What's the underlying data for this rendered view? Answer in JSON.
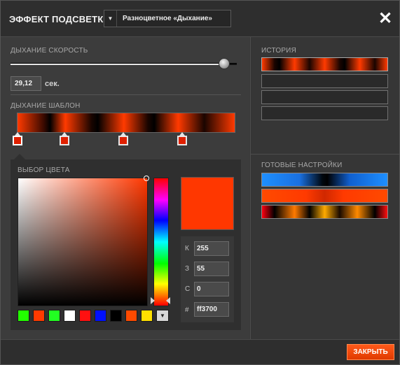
{
  "window": {
    "title": "ЭФФЕКТ ПОДСВЕТКИ",
    "effect_dropdown": {
      "arrow": "▼",
      "selected": "Разноцветное «Дыхание»"
    },
    "close_glyph": "✕"
  },
  "speed": {
    "label": "ДЫХАНИЕ СКОРОСТЬ",
    "value": "29,12",
    "unit": "сек.",
    "slider_fraction": 0.96
  },
  "pattern": {
    "label": "ДЫХАНИЕ ШАБЛОН",
    "stops": [
      {
        "color": "#e02000"
      },
      {
        "color": "#e02000"
      },
      {
        "color": "#e02000"
      },
      {
        "color": "#e02000"
      }
    ]
  },
  "color_picker": {
    "label": "ВЫБОР ЦВЕТА",
    "preview_color": "#ff3700",
    "fields": [
      {
        "label": "К",
        "value": "255"
      },
      {
        "label": "З",
        "value": "55"
      },
      {
        "label": "С",
        "value": "0"
      },
      {
        "label": "#",
        "value": "ff3700"
      }
    ],
    "swatches": [
      "#22ff00",
      "#ff3a00",
      "#22ff22",
      "#ffffff",
      "#ff1010",
      "#0010ff",
      "#000000",
      "#ff4a00",
      "#ffe000"
    ],
    "more_glyph": "▼"
  },
  "history": {
    "label": "ИСТОРИЯ",
    "rows": [
      "filled",
      "empty",
      "empty",
      "empty"
    ]
  },
  "presets": {
    "label": "ГОТОВЫЕ НАСТРОЙКИ",
    "items": [
      "blue-breath",
      "orange-solid",
      "multicolor-breath"
    ]
  },
  "footer": {
    "close_button": "ЗАКРЫТЬ"
  },
  "colors": {
    "accent": "#ff4a10",
    "background": "#3a3a3a"
  }
}
